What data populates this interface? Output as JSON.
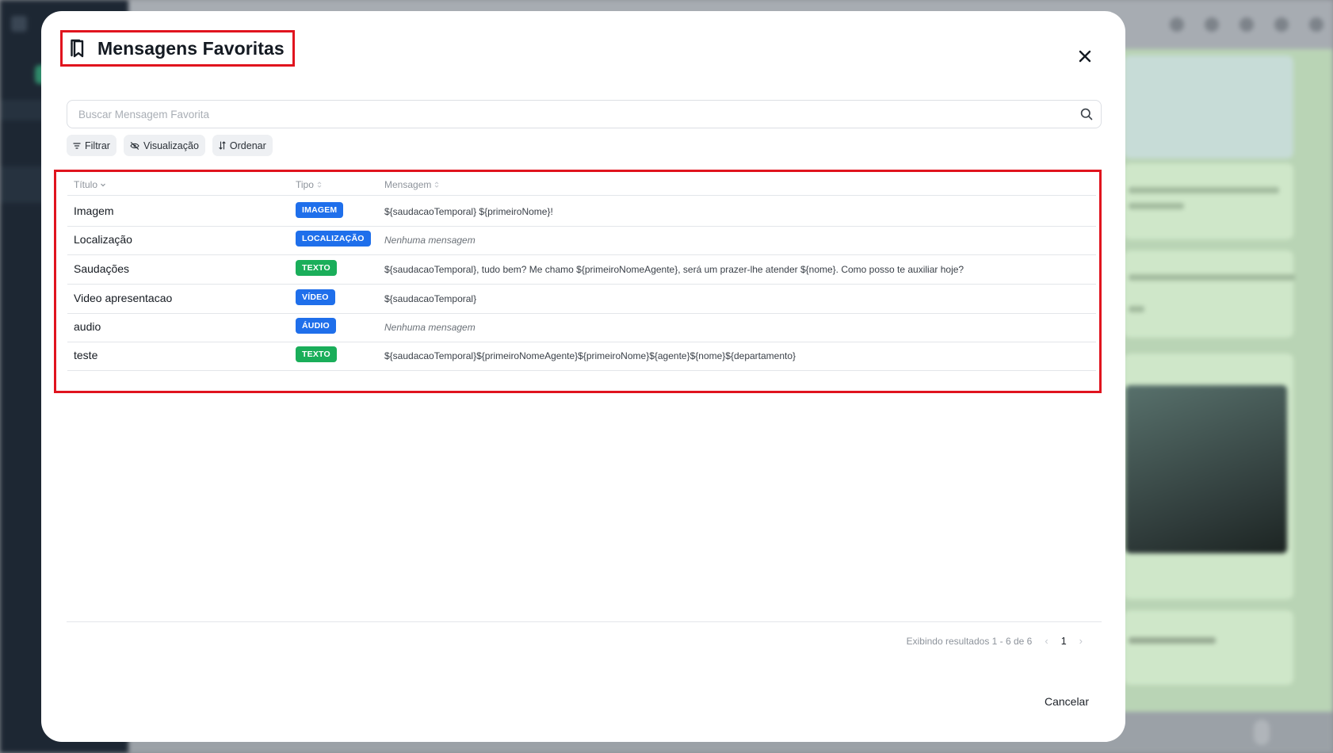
{
  "modal": {
    "title": "Mensagens Favoritas",
    "icon": "bookmarks-icon",
    "close_icon": "close-icon"
  },
  "search": {
    "placeholder": "Buscar Mensagem Favorita",
    "value": "",
    "icon": "search-icon"
  },
  "toolbar": {
    "filter_label": "Filtrar",
    "view_label": "Visualização",
    "sort_label": "Ordenar"
  },
  "table": {
    "columns": [
      {
        "label": "Título",
        "sort": "desc"
      },
      {
        "label": "Tipo",
        "sort": "none"
      },
      {
        "label": "Mensagem",
        "sort": "none"
      }
    ],
    "rows": [
      {
        "title": "Imagem",
        "type": "IMAGEM",
        "type_color": "#1f6feb",
        "message": "${saudacaoTemporal} ${primeiroNome}!",
        "empty": false
      },
      {
        "title": "Localização",
        "type": "LOCALIZAÇÃO",
        "type_color": "#1f6feb",
        "message": "Nenhuma mensagem",
        "empty": true
      },
      {
        "title": "Saudações",
        "type": "TEXTO",
        "type_color": "#1aae5a",
        "message": "${saudacaoTemporal}, tudo bem? Me chamo ${primeiroNomeAgente}, será um prazer-lhe atender ${nome}. Como posso te auxiliar hoje?",
        "empty": false
      },
      {
        "title": "Video apresentacao",
        "type": "VÍDEO",
        "type_color": "#1f6feb",
        "message": "${saudacaoTemporal}",
        "empty": false
      },
      {
        "title": "audio",
        "type": "ÁUDIO",
        "type_color": "#1f6feb",
        "message": "Nenhuma mensagem",
        "empty": true
      },
      {
        "title": "teste",
        "type": "TEXTO",
        "type_color": "#1aae5a",
        "message": "${saudacaoTemporal}${primeiroNomeAgente}${primeiroNome}${agente}${nome}${departamento}",
        "empty": false
      }
    ]
  },
  "pagination": {
    "summary": "Exibindo resultados 1 - 6 de 6",
    "current_page": "1",
    "prev": "‹",
    "next": "›"
  },
  "footer": {
    "cancel_label": "Cancelar"
  },
  "colors": {
    "highlight": "#e0141e",
    "badge_blue": "#1f6feb",
    "badge_green": "#1aae5a"
  }
}
